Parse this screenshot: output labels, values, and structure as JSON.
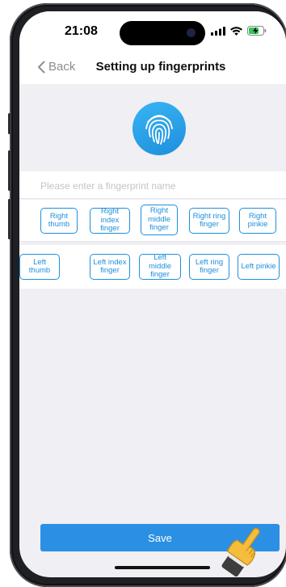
{
  "status_bar": {
    "time": "21:08"
  },
  "nav": {
    "back_label": "Back",
    "title": "Setting up fingerprints"
  },
  "hero": {
    "icon": "fingerprint-icon",
    "accent": "#1e8fdc"
  },
  "name_field": {
    "value": "",
    "placeholder": "Please enter a fingerprint name"
  },
  "right_hand": [
    "Right thumb",
    "Right index finger",
    "Right middle finger",
    "Right ring finger",
    "Right pinkie"
  ],
  "left_hand": [
    "Left thumb",
    "Left index finger",
    "Left middle finger",
    "Left ring finger",
    "Left pinkie"
  ],
  "footer": {
    "save_label": "Save",
    "save_color": "#2b8fe4"
  }
}
